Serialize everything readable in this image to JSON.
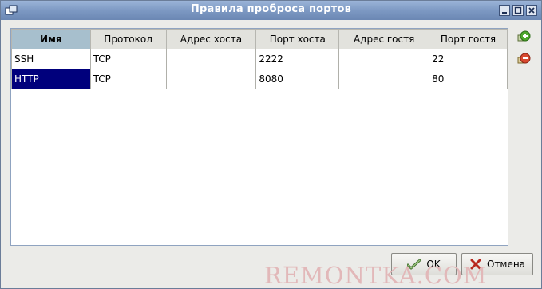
{
  "window": {
    "title": "Правила проброса портов"
  },
  "table": {
    "headers": [
      "Имя",
      "Протокол",
      "Адрес хоста",
      "Порт хоста",
      "Адрес гостя",
      "Порт гостя"
    ],
    "rows": [
      [
        "SSH",
        "TCP",
        "",
        "2222",
        "",
        "22"
      ],
      [
        "HTTP",
        "TCP",
        "",
        "8080",
        "",
        "80"
      ]
    ]
  },
  "side_buttons": {
    "add_icon": "add-rule-icon",
    "remove_icon": "remove-rule-icon"
  },
  "footer": {
    "ok_label": "OK",
    "cancel_label": "Отмена"
  },
  "watermark": "REMONTKA.COM",
  "colors": {
    "titlebar": "#7d99c3",
    "selection": "#00007c",
    "sorted_header": "#a7bfcd",
    "watermark": "#e2b8b9"
  }
}
